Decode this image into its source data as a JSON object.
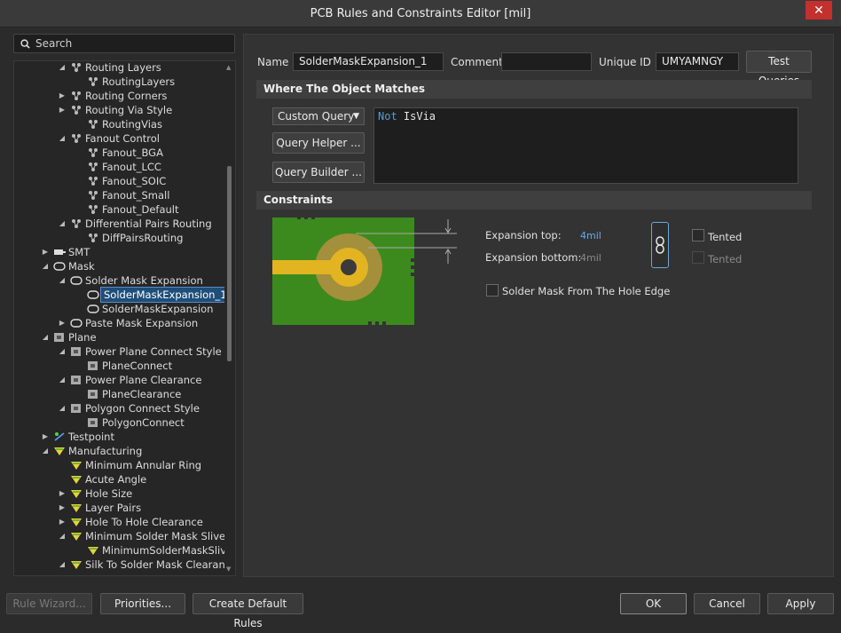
{
  "window": {
    "title": "PCB Rules and Constraints Editor [mil]"
  },
  "search": {
    "placeholder": "Search"
  },
  "tree": [
    {
      "label": "Routing Layers",
      "level": 1,
      "expand": "open",
      "icon": "rule"
    },
    {
      "label": "RoutingLayers",
      "level": 2,
      "expand": "none",
      "icon": "rule"
    },
    {
      "label": "Routing Corners",
      "level": 1,
      "expand": "closed",
      "icon": "rule"
    },
    {
      "label": "Routing Via Style",
      "level": 1,
      "expand": "closed",
      "icon": "rule"
    },
    {
      "label": "RoutingVias",
      "level": 2,
      "expand": "none",
      "icon": "rule"
    },
    {
      "label": "Fanout Control",
      "level": 1,
      "expand": "open",
      "icon": "rule"
    },
    {
      "label": "Fanout_BGA",
      "level": 2,
      "expand": "none",
      "icon": "rule"
    },
    {
      "label": "Fanout_LCC",
      "level": 2,
      "expand": "none",
      "icon": "rule"
    },
    {
      "label": "Fanout_SOIC",
      "level": 2,
      "expand": "none",
      "icon": "rule"
    },
    {
      "label": "Fanout_Small",
      "level": 2,
      "expand": "none",
      "icon": "rule"
    },
    {
      "label": "Fanout_Default",
      "level": 2,
      "expand": "none",
      "icon": "rule"
    },
    {
      "label": "Differential Pairs Routing",
      "level": 1,
      "expand": "open",
      "icon": "rule"
    },
    {
      "label": "DiffPairsRouting",
      "level": 2,
      "expand": "none",
      "icon": "rule"
    },
    {
      "label": "SMT",
      "level": 0,
      "expand": "closed",
      "icon": "smt"
    },
    {
      "label": "Mask",
      "level": 0,
      "expand": "open",
      "icon": "mask"
    },
    {
      "label": "Solder Mask Expansion",
      "level": 1,
      "expand": "open",
      "icon": "mask"
    },
    {
      "label": "SolderMaskExpansion_1",
      "level": 2,
      "expand": "none",
      "icon": "mask",
      "selected": true
    },
    {
      "label": "SolderMaskExpansion",
      "level": 2,
      "expand": "none",
      "icon": "mask"
    },
    {
      "label": "Paste Mask Expansion",
      "level": 1,
      "expand": "closed",
      "icon": "mask"
    },
    {
      "label": "Plane",
      "level": 0,
      "expand": "open",
      "icon": "plane"
    },
    {
      "label": "Power Plane Connect Style",
      "level": 1,
      "expand": "open",
      "icon": "plane"
    },
    {
      "label": "PlaneConnect",
      "level": 2,
      "expand": "none",
      "icon": "plane"
    },
    {
      "label": "Power Plane Clearance",
      "level": 1,
      "expand": "open",
      "icon": "plane"
    },
    {
      "label": "PlaneClearance",
      "level": 2,
      "expand": "none",
      "icon": "plane"
    },
    {
      "label": "Polygon Connect Style",
      "level": 1,
      "expand": "open",
      "icon": "plane"
    },
    {
      "label": "PolygonConnect",
      "level": 2,
      "expand": "none",
      "icon": "plane"
    },
    {
      "label": "Testpoint",
      "level": 0,
      "expand": "closed",
      "icon": "testpoint"
    },
    {
      "label": "Manufacturing",
      "level": 0,
      "expand": "open",
      "icon": "mfg"
    },
    {
      "label": "Minimum Annular Ring",
      "level": 1,
      "expand": "none",
      "icon": "mfg"
    },
    {
      "label": "Acute Angle",
      "level": 1,
      "expand": "none",
      "icon": "mfg"
    },
    {
      "label": "Hole Size",
      "level": 1,
      "expand": "closed",
      "icon": "mfg"
    },
    {
      "label": "Layer Pairs",
      "level": 1,
      "expand": "closed",
      "icon": "mfg"
    },
    {
      "label": "Hole To Hole Clearance",
      "level": 1,
      "expand": "closed",
      "icon": "mfg"
    },
    {
      "label": "Minimum Solder Mask Sliver",
      "level": 1,
      "expand": "open",
      "icon": "mfg"
    },
    {
      "label": "MinimumSolderMaskSliver",
      "level": 2,
      "expand": "none",
      "icon": "mfg"
    },
    {
      "label": "Silk To Solder Mask Clearance",
      "level": 1,
      "expand": "open",
      "icon": "mfg"
    }
  ],
  "rule": {
    "name_label": "Name",
    "name_value": "SolderMaskExpansion_1",
    "comment_label": "Comment",
    "comment_value": "",
    "uid_label": "Unique ID",
    "uid_value": "UMYAMNGY",
    "test_queries": "Test Queries"
  },
  "match": {
    "section_title": "Where The Object Matches",
    "query_type": "Custom Query",
    "query_helper": "Query Helper ...",
    "query_builder": "Query Builder ...",
    "query_keyword": "Not",
    "query_rest": " IsVia"
  },
  "constraints": {
    "section_title": "Constraints",
    "expansion_top_label": "Expansion top:",
    "expansion_top_value": "4mil",
    "expansion_bottom_label": "Expansion bottom:",
    "expansion_bottom_value": "4mil",
    "tented_top": "Tented",
    "tented_bottom": "Tented",
    "hole_edge": "Solder Mask From The Hole Edge"
  },
  "footer": {
    "rule_wizard": "Rule Wizard...",
    "priorities": "Priorities...",
    "create_default": "Create Default Rules",
    "ok": "OK",
    "cancel": "Cancel",
    "apply": "Apply"
  },
  "colors": {
    "board": "#3c8a1e",
    "copper": "#e2b422",
    "annular": "#a38f3c",
    "hole": "#3a3a3a",
    "accent": "#69a9e6"
  }
}
